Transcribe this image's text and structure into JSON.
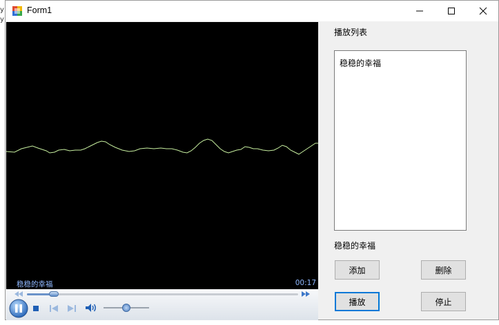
{
  "window": {
    "title": "Form1",
    "minimize_glyph": "—",
    "maximize_glyph": "☐",
    "close_glyph": "✕"
  },
  "player": {
    "now_playing": "稳稳的幸福",
    "time": "00:17",
    "seek_progress": 0.1,
    "volume_level": 0.5,
    "visualizer_color": "#c8f0a0"
  },
  "playlist": {
    "label": "播放列表",
    "items": [
      "稳稳的幸福"
    ],
    "current_song": "稳稳的幸福"
  },
  "buttons": {
    "add": "添加",
    "delete": "删除",
    "play": "播放",
    "stop": "停止"
  }
}
